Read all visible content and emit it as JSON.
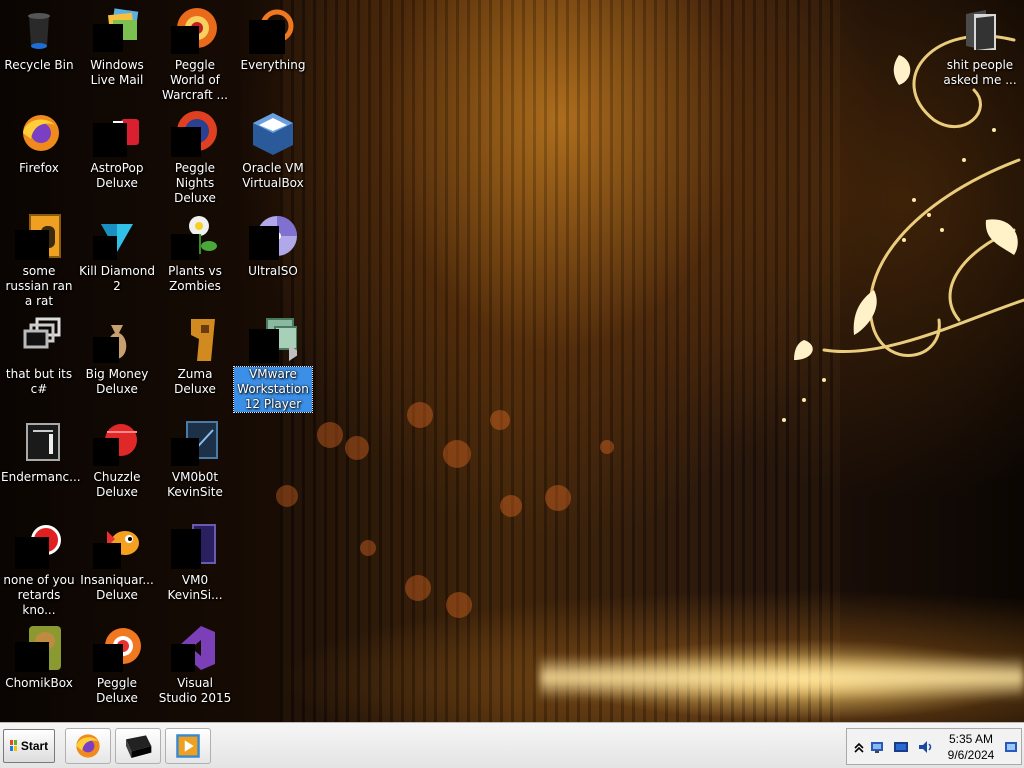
{
  "desktop": {
    "icons": [
      {
        "label": "Recycle Bin",
        "icon": "recycle-bin-icon"
      },
      {
        "label": "Windows Live Mail",
        "icon": "mail-icon"
      },
      {
        "label": "Peggle World of Warcraft ...",
        "icon": "peggle-icon"
      },
      {
        "label": "Everything",
        "icon": "search-icon"
      },
      {
        "label": "Firefox",
        "icon": "firefox-icon"
      },
      {
        "label": "AstroPop Deluxe",
        "icon": "astropop-icon"
      },
      {
        "label": "Peggle Nights Deluxe",
        "icon": "peggle-nights-icon"
      },
      {
        "label": "Oracle VM VirtualBox",
        "icon": "virtualbox-icon"
      },
      {
        "label": "some russian ran a rat",
        "icon": "shortcut-icon"
      },
      {
        "label": "Kill Diamond 2",
        "icon": "diamond-icon"
      },
      {
        "label": "Plants vs Zombies",
        "icon": "plants-icon"
      },
      {
        "label": "UltraISO",
        "icon": "disc-icon"
      },
      {
        "label": "that but its c#",
        "icon": "file-icon"
      },
      {
        "label": "Big Money Deluxe",
        "icon": "money-bag-icon"
      },
      {
        "label": "Zuma Deluxe",
        "icon": "zuma-icon"
      },
      {
        "label": "VMware Workstation 12 Player",
        "icon": "vmware-icon"
      },
      {
        "label": "Endermanc...",
        "icon": "terminal-icon"
      },
      {
        "label": "Chuzzle Deluxe",
        "icon": "chuzzle-icon"
      },
      {
        "label": "VM0b0t KevinSite",
        "icon": "vm-site-icon"
      },
      {
        "label": "none of you retards kno...",
        "icon": "app-icon"
      },
      {
        "label": "Insaniquar... Deluxe",
        "icon": "fish-icon"
      },
      {
        "label": "VM0 KevinSi...",
        "icon": "document-icon"
      },
      {
        "label": "ChomikBox",
        "icon": "chomikbox-icon"
      },
      {
        "label": "Peggle Deluxe",
        "icon": "peggle-deluxe-icon"
      },
      {
        "label": "Visual Studio 2015",
        "icon": "visual-studio-icon"
      },
      {
        "label": "shit people asked me ...",
        "icon": "folder-icon"
      }
    ],
    "selected": "VMware Workstation 12 Player"
  },
  "taskbar": {
    "start_label": "Start",
    "pinned": [
      {
        "icon": "firefox-icon"
      },
      {
        "icon": "terminal-icon"
      },
      {
        "icon": "media-player-icon"
      }
    ],
    "tray": {
      "icons": [
        "show-hidden-icons-chevron-icon",
        "network-icon",
        "display-icon",
        "volume-icon"
      ],
      "time": "5:35 AM",
      "date": "9/6/2024",
      "show_desktop_icon": "show-desktop-icon"
    }
  }
}
